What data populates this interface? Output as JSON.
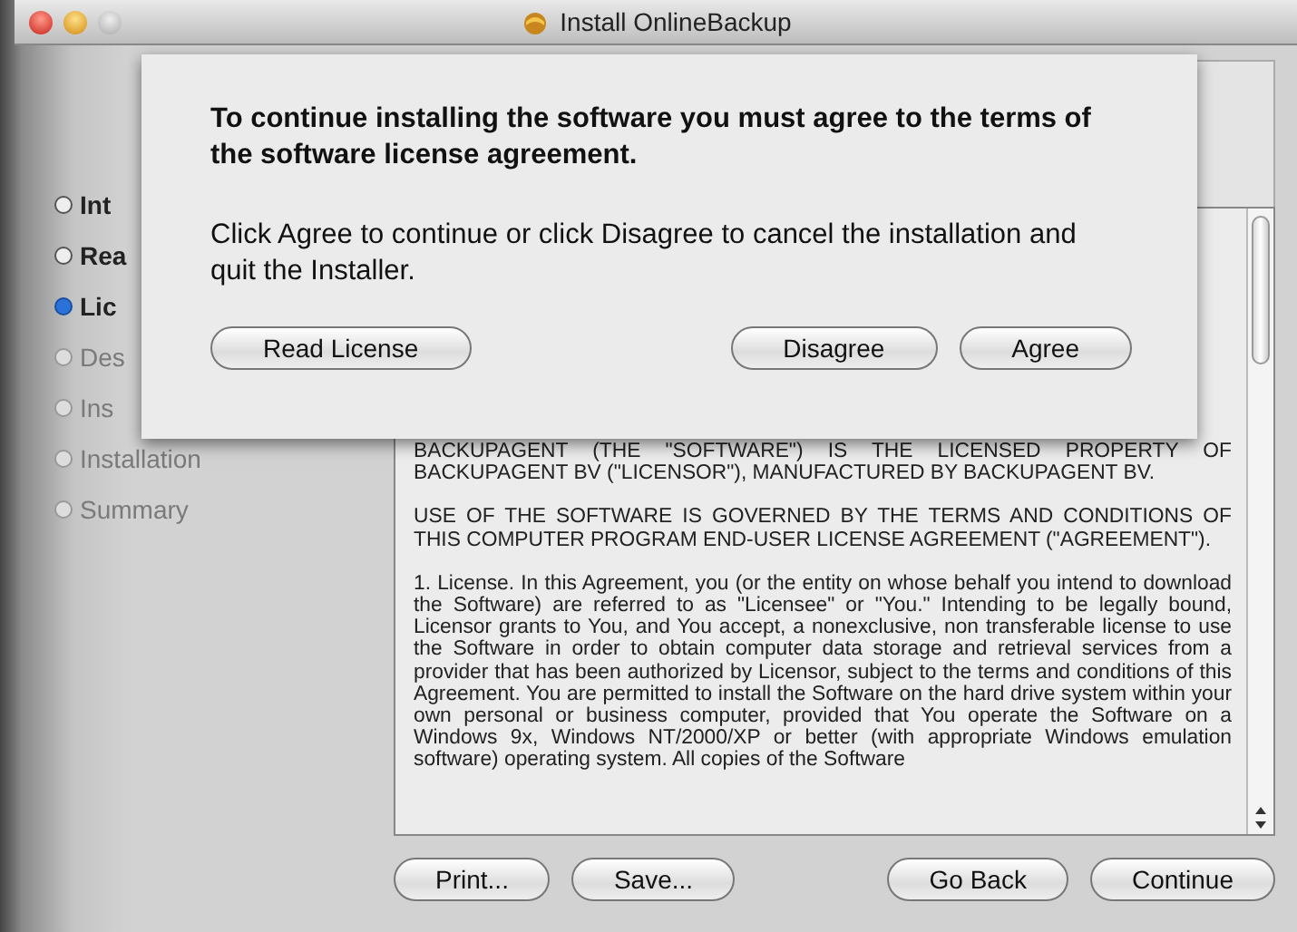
{
  "window": {
    "title": "Install OnlineBackup"
  },
  "sidebar": {
    "items": [
      {
        "label": "Int",
        "selected": false,
        "disabled": false
      },
      {
        "label": "Rea",
        "selected": false,
        "disabled": false
      },
      {
        "label": "Lic",
        "selected": true,
        "disabled": false
      },
      {
        "label": "Des",
        "selected": false,
        "disabled": true
      },
      {
        "label": "Ins",
        "selected": false,
        "disabled": true
      },
      {
        "label": "Installation",
        "selected": false,
        "disabled": true
      },
      {
        "label": "Summary",
        "selected": false,
        "disabled": true
      }
    ]
  },
  "license_text": {
    "paragraphs": [
      "BACKUPAGENT (THE \"SOFTWARE\") IS THE LICENSED PROPERTY OF BACKUPAGENT BV (\"LICENSOR\"), MANUFACTURED BY BACKUPAGENT BV.",
      "USE OF THE SOFTWARE IS GOVERNED BY THE TERMS AND CONDITIONS OF THIS COMPUTER PROGRAM END-USER LICENSE AGREEMENT (\"AGREEMENT\").",
      "1. License. In this Agreement, you (or the entity on whose behalf you intend to download the Software) are referred to as \"Licensee\" or \"You.\" Intending to be legally bound, Licensor grants to You, and You accept, a nonexclusive, non transferable license to use the Software in order to obtain computer data storage and retrieval services from a provider that has been authorized by Licensor, subject to the terms and conditions of this Agreement. You are permitted to install the Software on the hard drive system within your own personal or business computer, provided that You operate the Software on a Windows 9x, Windows NT/2000/XP or better (with appropriate Windows emulation software) operating system. All copies of the Software"
    ]
  },
  "footer_buttons": [
    "Print...",
    "Save...",
    "Go Back",
    "Continue"
  ],
  "sheet": {
    "title": "To continue installing the software you must agree to the terms of the software license agreement.",
    "message": "Click Agree to continue or click Disagree to cancel the installation and quit the Installer.",
    "buttons": [
      "Read License",
      "Disagree",
      "Agree"
    ]
  }
}
